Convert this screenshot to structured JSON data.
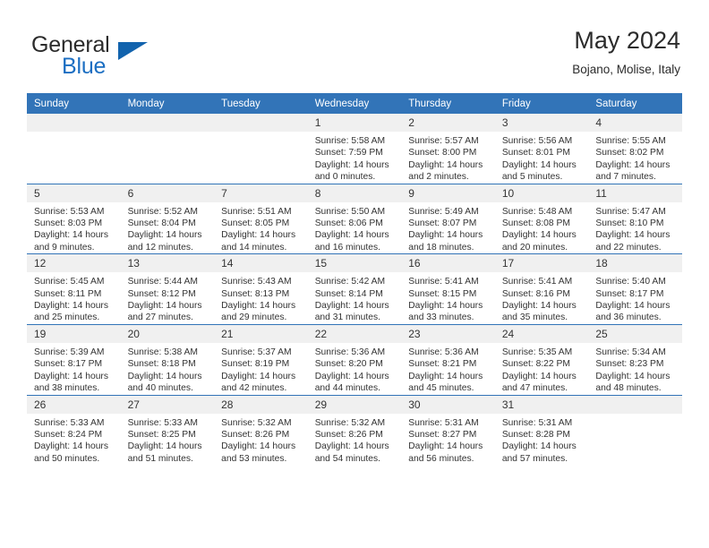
{
  "brand": {
    "name_part1": "General",
    "name_part2": "Blue",
    "accent_color": "#1263ad"
  },
  "header": {
    "title": "May 2024",
    "location": "Bojano, Molise, Italy"
  },
  "calendar": {
    "header_bg": "#3274b8",
    "date_band_bg": "#f0f0f0",
    "weekdays": [
      "Sunday",
      "Monday",
      "Tuesday",
      "Wednesday",
      "Thursday",
      "Friday",
      "Saturday"
    ],
    "weeks": [
      [
        {
          "day": "",
          "empty": true,
          "sunrise": "",
          "sunset": "",
          "daylight1": "",
          "daylight2": ""
        },
        {
          "day": "",
          "empty": true,
          "sunrise": "",
          "sunset": "",
          "daylight1": "",
          "daylight2": ""
        },
        {
          "day": "",
          "empty": true,
          "sunrise": "",
          "sunset": "",
          "daylight1": "",
          "daylight2": ""
        },
        {
          "day": "1",
          "empty": false,
          "sunrise": "Sunrise: 5:58 AM",
          "sunset": "Sunset: 7:59 PM",
          "daylight1": "Daylight: 14 hours",
          "daylight2": "and 0 minutes."
        },
        {
          "day": "2",
          "empty": false,
          "sunrise": "Sunrise: 5:57 AM",
          "sunset": "Sunset: 8:00 PM",
          "daylight1": "Daylight: 14 hours",
          "daylight2": "and 2 minutes."
        },
        {
          "day": "3",
          "empty": false,
          "sunrise": "Sunrise: 5:56 AM",
          "sunset": "Sunset: 8:01 PM",
          "daylight1": "Daylight: 14 hours",
          "daylight2": "and 5 minutes."
        },
        {
          "day": "4",
          "empty": false,
          "sunrise": "Sunrise: 5:55 AM",
          "sunset": "Sunset: 8:02 PM",
          "daylight1": "Daylight: 14 hours",
          "daylight2": "and 7 minutes."
        }
      ],
      [
        {
          "day": "5",
          "empty": false,
          "sunrise": "Sunrise: 5:53 AM",
          "sunset": "Sunset: 8:03 PM",
          "daylight1": "Daylight: 14 hours",
          "daylight2": "and 9 minutes."
        },
        {
          "day": "6",
          "empty": false,
          "sunrise": "Sunrise: 5:52 AM",
          "sunset": "Sunset: 8:04 PM",
          "daylight1": "Daylight: 14 hours",
          "daylight2": "and 12 minutes."
        },
        {
          "day": "7",
          "empty": false,
          "sunrise": "Sunrise: 5:51 AM",
          "sunset": "Sunset: 8:05 PM",
          "daylight1": "Daylight: 14 hours",
          "daylight2": "and 14 minutes."
        },
        {
          "day": "8",
          "empty": false,
          "sunrise": "Sunrise: 5:50 AM",
          "sunset": "Sunset: 8:06 PM",
          "daylight1": "Daylight: 14 hours",
          "daylight2": "and 16 minutes."
        },
        {
          "day": "9",
          "empty": false,
          "sunrise": "Sunrise: 5:49 AM",
          "sunset": "Sunset: 8:07 PM",
          "daylight1": "Daylight: 14 hours",
          "daylight2": "and 18 minutes."
        },
        {
          "day": "10",
          "empty": false,
          "sunrise": "Sunrise: 5:48 AM",
          "sunset": "Sunset: 8:08 PM",
          "daylight1": "Daylight: 14 hours",
          "daylight2": "and 20 minutes."
        },
        {
          "day": "11",
          "empty": false,
          "sunrise": "Sunrise: 5:47 AM",
          "sunset": "Sunset: 8:10 PM",
          "daylight1": "Daylight: 14 hours",
          "daylight2": "and 22 minutes."
        }
      ],
      [
        {
          "day": "12",
          "empty": false,
          "sunrise": "Sunrise: 5:45 AM",
          "sunset": "Sunset: 8:11 PM",
          "daylight1": "Daylight: 14 hours",
          "daylight2": "and 25 minutes."
        },
        {
          "day": "13",
          "empty": false,
          "sunrise": "Sunrise: 5:44 AM",
          "sunset": "Sunset: 8:12 PM",
          "daylight1": "Daylight: 14 hours",
          "daylight2": "and 27 minutes."
        },
        {
          "day": "14",
          "empty": false,
          "sunrise": "Sunrise: 5:43 AM",
          "sunset": "Sunset: 8:13 PM",
          "daylight1": "Daylight: 14 hours",
          "daylight2": "and 29 minutes."
        },
        {
          "day": "15",
          "empty": false,
          "sunrise": "Sunrise: 5:42 AM",
          "sunset": "Sunset: 8:14 PM",
          "daylight1": "Daylight: 14 hours",
          "daylight2": "and 31 minutes."
        },
        {
          "day": "16",
          "empty": false,
          "sunrise": "Sunrise: 5:41 AM",
          "sunset": "Sunset: 8:15 PM",
          "daylight1": "Daylight: 14 hours",
          "daylight2": "and 33 minutes."
        },
        {
          "day": "17",
          "empty": false,
          "sunrise": "Sunrise: 5:41 AM",
          "sunset": "Sunset: 8:16 PM",
          "daylight1": "Daylight: 14 hours",
          "daylight2": "and 35 minutes."
        },
        {
          "day": "18",
          "empty": false,
          "sunrise": "Sunrise: 5:40 AM",
          "sunset": "Sunset: 8:17 PM",
          "daylight1": "Daylight: 14 hours",
          "daylight2": "and 36 minutes."
        }
      ],
      [
        {
          "day": "19",
          "empty": false,
          "sunrise": "Sunrise: 5:39 AM",
          "sunset": "Sunset: 8:17 PM",
          "daylight1": "Daylight: 14 hours",
          "daylight2": "and 38 minutes."
        },
        {
          "day": "20",
          "empty": false,
          "sunrise": "Sunrise: 5:38 AM",
          "sunset": "Sunset: 8:18 PM",
          "daylight1": "Daylight: 14 hours",
          "daylight2": "and 40 minutes."
        },
        {
          "day": "21",
          "empty": false,
          "sunrise": "Sunrise: 5:37 AM",
          "sunset": "Sunset: 8:19 PM",
          "daylight1": "Daylight: 14 hours",
          "daylight2": "and 42 minutes."
        },
        {
          "day": "22",
          "empty": false,
          "sunrise": "Sunrise: 5:36 AM",
          "sunset": "Sunset: 8:20 PM",
          "daylight1": "Daylight: 14 hours",
          "daylight2": "and 44 minutes."
        },
        {
          "day": "23",
          "empty": false,
          "sunrise": "Sunrise: 5:36 AM",
          "sunset": "Sunset: 8:21 PM",
          "daylight1": "Daylight: 14 hours",
          "daylight2": "and 45 minutes."
        },
        {
          "day": "24",
          "empty": false,
          "sunrise": "Sunrise: 5:35 AM",
          "sunset": "Sunset: 8:22 PM",
          "daylight1": "Daylight: 14 hours",
          "daylight2": "and 47 minutes."
        },
        {
          "day": "25",
          "empty": false,
          "sunrise": "Sunrise: 5:34 AM",
          "sunset": "Sunset: 8:23 PM",
          "daylight1": "Daylight: 14 hours",
          "daylight2": "and 48 minutes."
        }
      ],
      [
        {
          "day": "26",
          "empty": false,
          "sunrise": "Sunrise: 5:33 AM",
          "sunset": "Sunset: 8:24 PM",
          "daylight1": "Daylight: 14 hours",
          "daylight2": "and 50 minutes."
        },
        {
          "day": "27",
          "empty": false,
          "sunrise": "Sunrise: 5:33 AM",
          "sunset": "Sunset: 8:25 PM",
          "daylight1": "Daylight: 14 hours",
          "daylight2": "and 51 minutes."
        },
        {
          "day": "28",
          "empty": false,
          "sunrise": "Sunrise: 5:32 AM",
          "sunset": "Sunset: 8:26 PM",
          "daylight1": "Daylight: 14 hours",
          "daylight2": "and 53 minutes."
        },
        {
          "day": "29",
          "empty": false,
          "sunrise": "Sunrise: 5:32 AM",
          "sunset": "Sunset: 8:26 PM",
          "daylight1": "Daylight: 14 hours",
          "daylight2": "and 54 minutes."
        },
        {
          "day": "30",
          "empty": false,
          "sunrise": "Sunrise: 5:31 AM",
          "sunset": "Sunset: 8:27 PM",
          "daylight1": "Daylight: 14 hours",
          "daylight2": "and 56 minutes."
        },
        {
          "day": "31",
          "empty": false,
          "sunrise": "Sunrise: 5:31 AM",
          "sunset": "Sunset: 8:28 PM",
          "daylight1": "Daylight: 14 hours",
          "daylight2": "and 57 minutes."
        },
        {
          "day": "",
          "empty": true,
          "sunrise": "",
          "sunset": "",
          "daylight1": "",
          "daylight2": ""
        }
      ]
    ]
  }
}
